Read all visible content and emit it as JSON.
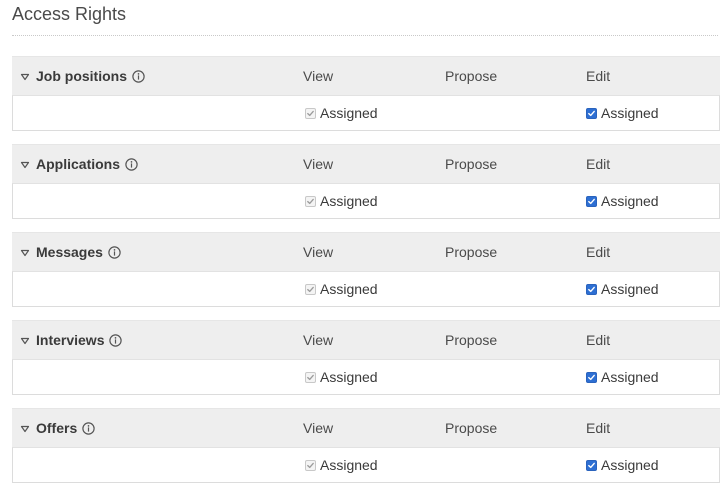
{
  "page": {
    "title": "Access Rights"
  },
  "columns": {
    "view": "View",
    "propose": "Propose",
    "edit": "Edit"
  },
  "sections": [
    {
      "title": "Job positions",
      "view_label": "Assigned",
      "edit_label": "Assigned",
      "view_checked": true,
      "view_disabled": true,
      "edit_checked": true
    },
    {
      "title": "Applications",
      "view_label": "Assigned",
      "edit_label": "Assigned",
      "view_checked": true,
      "view_disabled": true,
      "edit_checked": true
    },
    {
      "title": "Messages",
      "view_label": "Assigned",
      "edit_label": "Assigned",
      "view_checked": true,
      "view_disabled": true,
      "edit_checked": true
    },
    {
      "title": "Interviews",
      "view_label": "Assigned",
      "edit_label": "Assigned",
      "view_checked": true,
      "view_disabled": true,
      "edit_checked": true
    },
    {
      "title": "Offers",
      "view_label": "Assigned",
      "edit_label": "Assigned",
      "view_checked": true,
      "view_disabled": true,
      "edit_checked": true
    }
  ],
  "colors": {
    "checkbox_checked": "#2d6fd3",
    "header_bg": "#eeeeee"
  },
  "icons": {
    "collapse": "caret-down-icon",
    "info": "info-circle-icon",
    "check": "check-icon"
  }
}
